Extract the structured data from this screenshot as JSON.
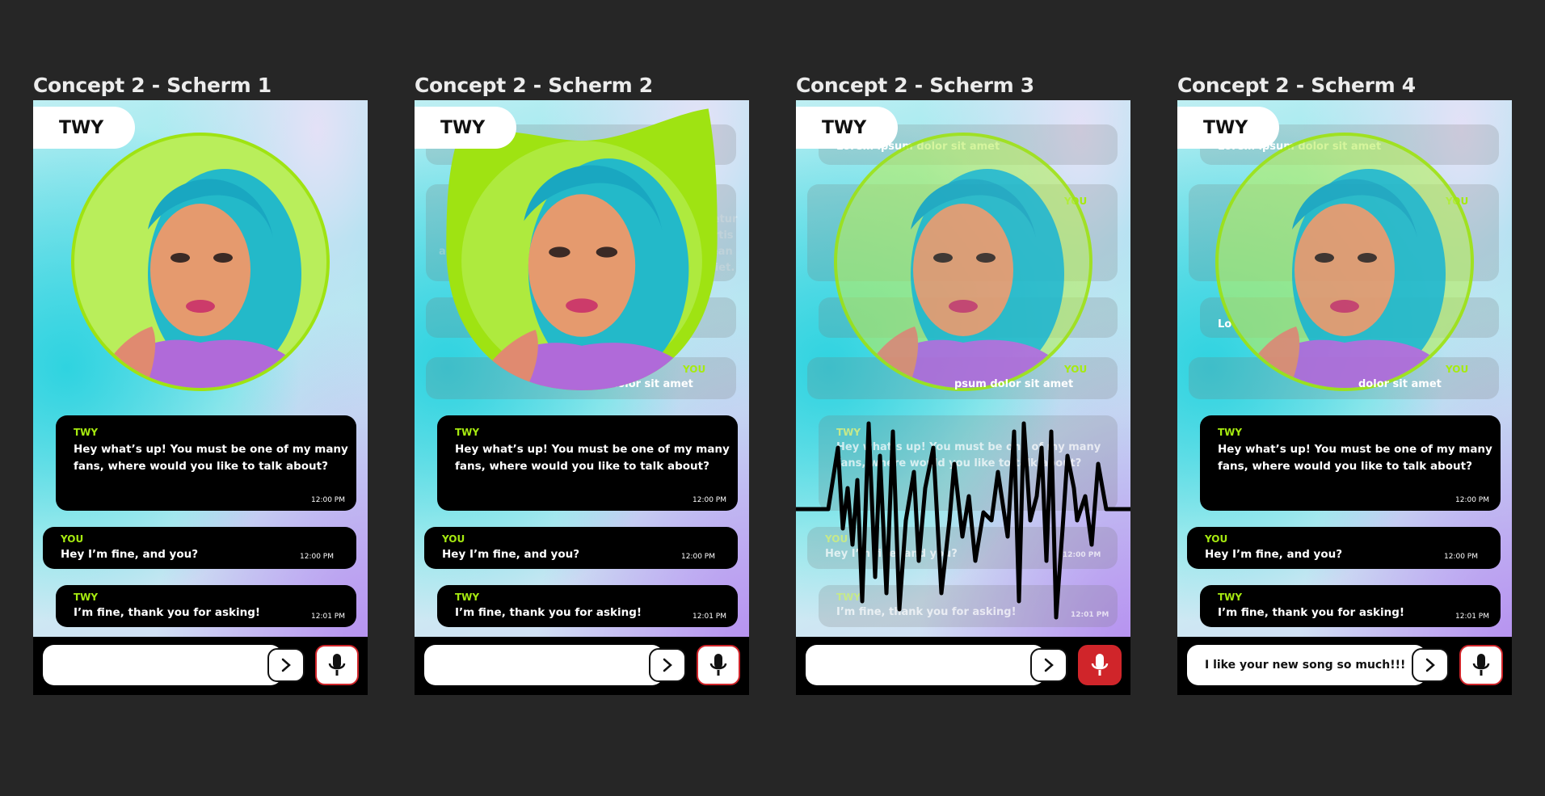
{
  "screens": [
    {
      "title": "Concept 2 - Scherm 1"
    },
    {
      "title": "Concept 2 - Scherm 2"
    },
    {
      "title": "Concept 2 - Scherm 3"
    },
    {
      "title": "Concept 2 - Scherm 4"
    }
  ],
  "brand": "TWY",
  "ghost_messages": {
    "top": "Lorem ipsum dolor sit amet",
    "you_label": "YOU",
    "para_lines": [
      "Lorem ip",
      "onsectetur",
      "adip",
      "m lobortis",
      "accumsan",
      "n. Aenean",
      "auctor",
      "imperdiet."
    ],
    "lo": "Lo",
    "bottom": "dolor sit amet",
    "bottom_s3": "psum dolor sit amet"
  },
  "messages": {
    "twy1": {
      "sender": "TWY",
      "line1": "Hey what’s up! You must be one of my many",
      "line2": "fans, where would you like to talk about?",
      "time": "12:00 PM"
    },
    "you": {
      "sender": "YOU",
      "text": "Hey I’m fine, and you?",
      "time": "12:00 PM"
    },
    "twy2": {
      "sender": "TWY",
      "text": "I’m fine, thank you for asking!",
      "time": "12:01 PM"
    }
  },
  "screen4_input_value": "I like your new song so much!!!",
  "icons": {
    "send": "chevron-right-icon",
    "mic": "microphone-icon"
  },
  "colors": {
    "accent_green": "#a6ea10",
    "mic_red": "#d0252a",
    "bubble": "#000000",
    "background": "#262626"
  }
}
